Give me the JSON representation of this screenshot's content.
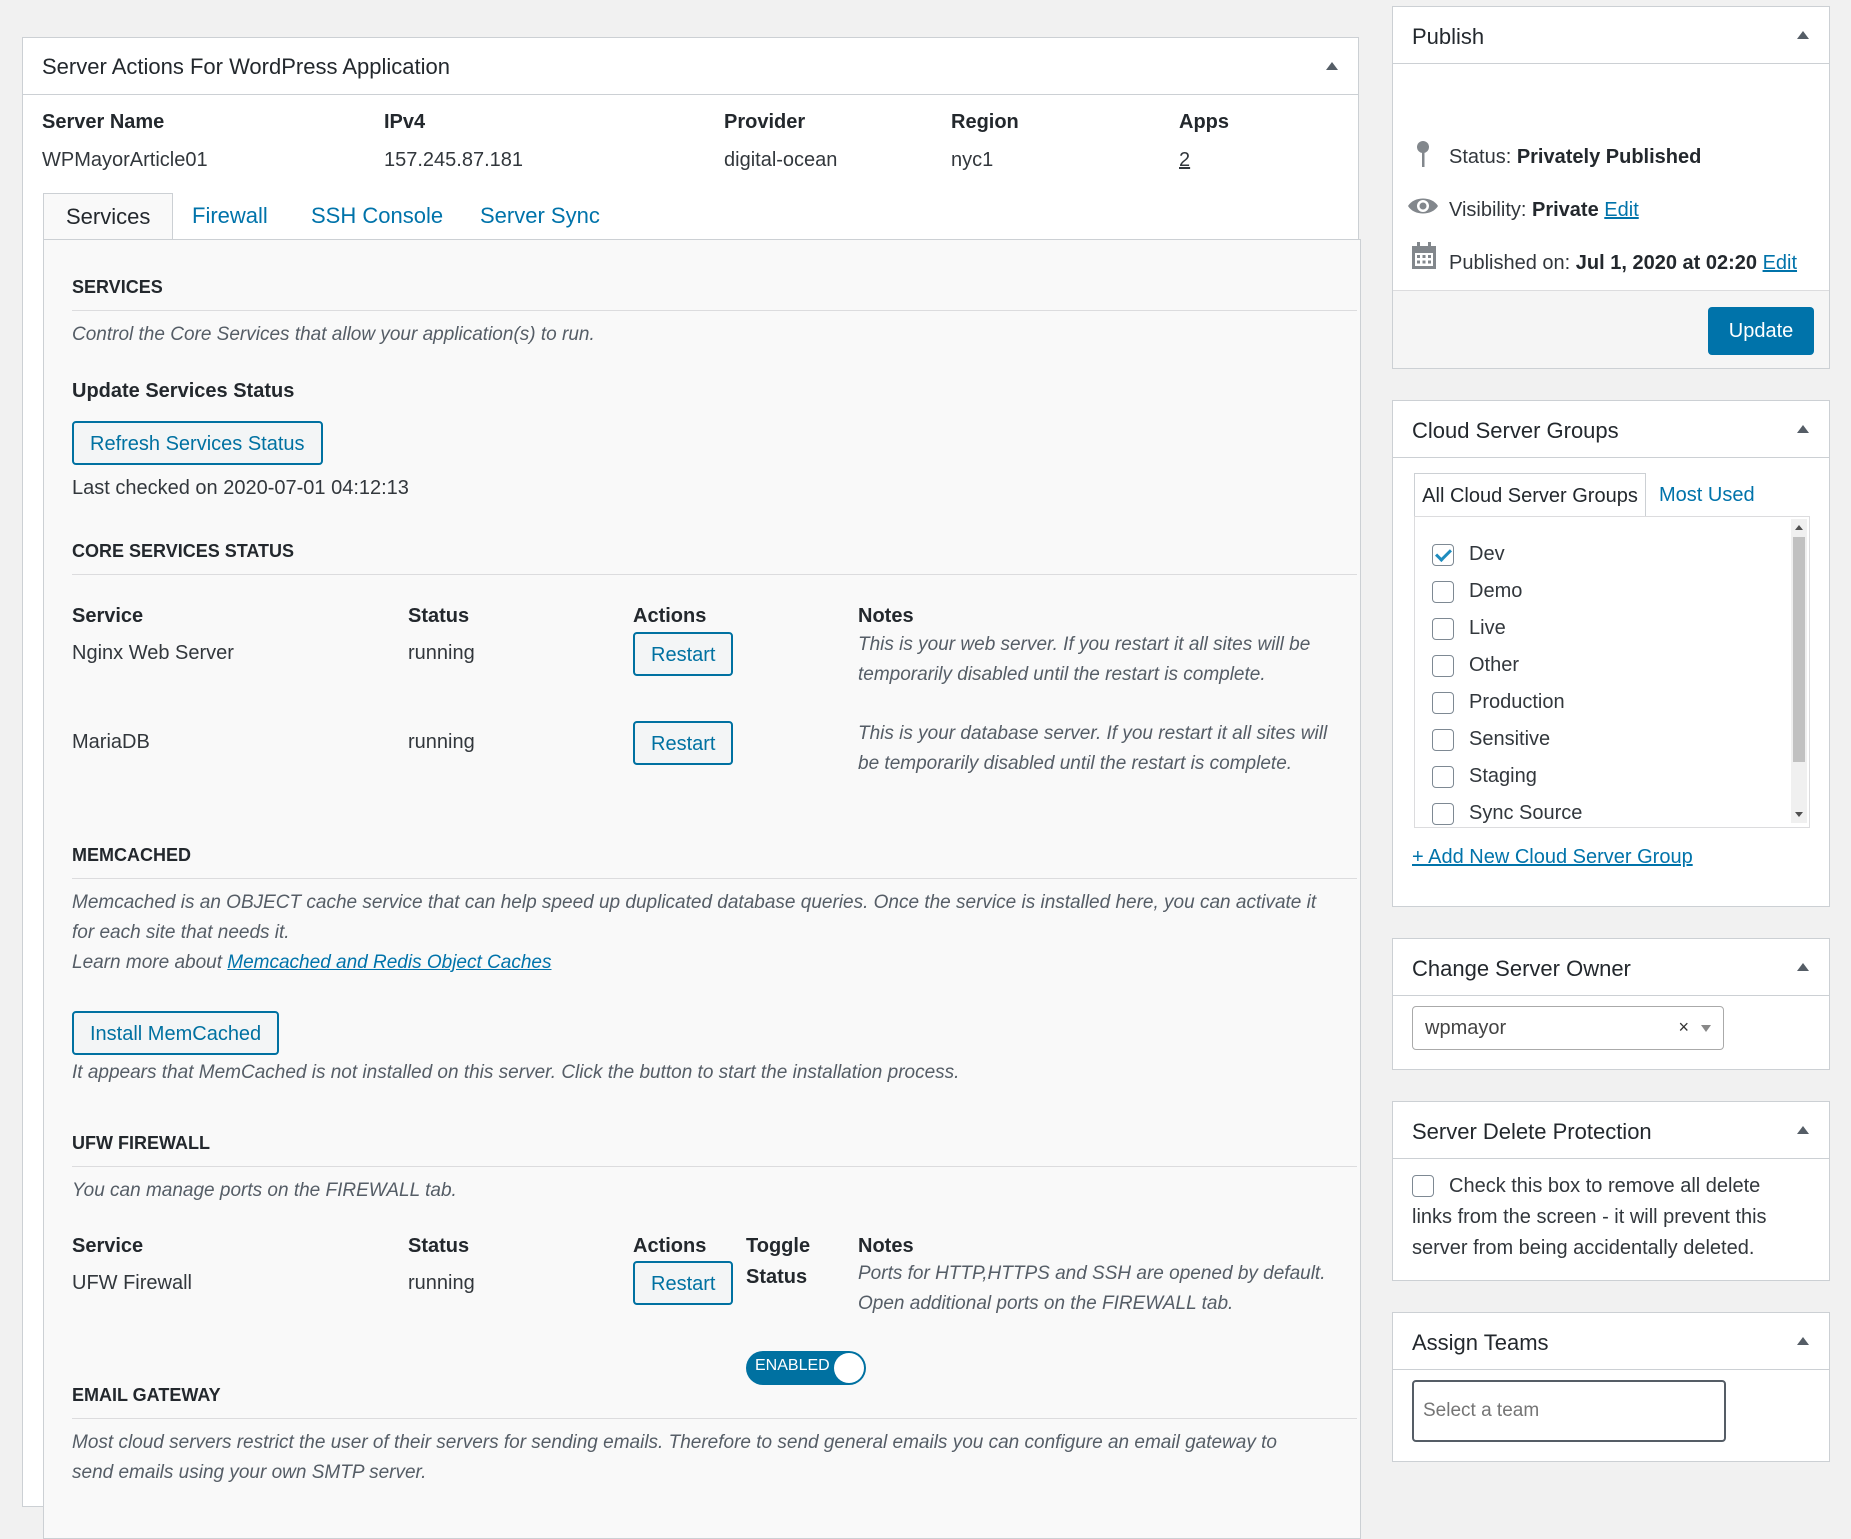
{
  "main": {
    "title": "Server Actions For WordPress Application",
    "columns": {
      "headers": [
        "Server Name",
        "IPv4",
        "Provider",
        "Region",
        "Apps"
      ],
      "values": [
        "WPMayorArticle01",
        "157.245.87.181",
        "digital-ocean",
        "nyc1",
        "2"
      ]
    },
    "tabs": [
      "Services",
      "Firewall",
      "SSH Console",
      "Server Sync"
    ],
    "services": {
      "title": "SERVICES",
      "desc": "Control the Core Services that allow your application(s) to run.",
      "update_heading": "Update Services Status",
      "refresh_button": "Refresh Services Status",
      "last_checked": "Last checked on 2020-07-01 04:12:13"
    },
    "core": {
      "title": "CORE SERVICES STATUS",
      "headers": [
        "Service",
        "Status",
        "Actions",
        "Notes"
      ],
      "rows": [
        {
          "service": "Nginx Web Server",
          "status": "running",
          "action": "Restart",
          "note1": "This is your web server. If you restart it all sites will be",
          "note2": "temporarily disabled until the restart is complete."
        },
        {
          "service": "MariaDB",
          "status": "running",
          "action": "Restart",
          "note1": "This is your database server. If you restart it all sites will",
          "note2": "be temporarily disabled until the restart is complete."
        }
      ]
    },
    "memcached": {
      "title": "MEMCACHED",
      "desc1": "Memcached is an OBJECT cache service that can help speed up duplicated database queries. Once the service is installed here, you can activate it",
      "desc2": "for each site that needs it.",
      "learn_prefix": "Learn more about ",
      "learn_link": "Memcached and Redis Object Caches",
      "install_button": "Install MemCached",
      "note": "It appears that MemCached is not installed on this server. Click the button to start the installation process."
    },
    "ufw": {
      "title": "UFW FIREWALL",
      "desc": "You can manage ports on the FIREWALL tab.",
      "headers": [
        "Service",
        "Status",
        "Actions",
        "Toggle",
        "Status",
        "Notes"
      ],
      "service": "UFW Firewall",
      "status": "running",
      "action": "Restart",
      "toggle_label": "ENABLED",
      "note1": "Ports for HTTP,HTTPS and SSH are opened by default.",
      "note2": "Open additional ports on the FIREWALL tab."
    },
    "email": {
      "title": "EMAIL GATEWAY",
      "desc1": "Most cloud servers restrict the user of their servers for sending emails. Therefore to send general emails you can configure an email gateway to",
      "desc2": "send emails using your own SMTP server."
    }
  },
  "sidebar": {
    "publish": {
      "title": "Publish",
      "status_label": "Status: ",
      "status_value": "Privately Published",
      "visibility_label": "Visibility: ",
      "visibility_value": "Private",
      "visibility_edit": "Edit",
      "published_label": "Published on: ",
      "published_value": "Jul 1, 2020 at 02:20",
      "published_edit": "Edit",
      "update_button": "Update"
    },
    "groups": {
      "title": "Cloud Server Groups",
      "tab_all": "All Cloud Server Groups",
      "tab_most": "Most Used",
      "items": [
        {
          "label": "Dev",
          "checked": true
        },
        {
          "label": "Demo",
          "checked": false
        },
        {
          "label": "Live",
          "checked": false
        },
        {
          "label": "Other",
          "checked": false
        },
        {
          "label": "Production",
          "checked": false
        },
        {
          "label": "Sensitive",
          "checked": false
        },
        {
          "label": "Staging",
          "checked": false
        },
        {
          "label": "Sync Source",
          "checked": false
        }
      ],
      "add_link": "+ Add New Cloud Server Group"
    },
    "owner": {
      "title": "Change Server Owner",
      "value": "wpmayor",
      "clear": "×"
    },
    "delete_protection": {
      "title": "Server Delete Protection",
      "line1": "Check this box to remove all delete",
      "line2": "links from the screen - it will prevent this",
      "line3": "server from being accidentally deleted."
    },
    "teams": {
      "title": "Assign Teams",
      "placeholder": "Select a team"
    }
  },
  "colors": {
    "accent": "#0073aa",
    "button_border": "#0071a1",
    "background": "#f1f1f1"
  }
}
